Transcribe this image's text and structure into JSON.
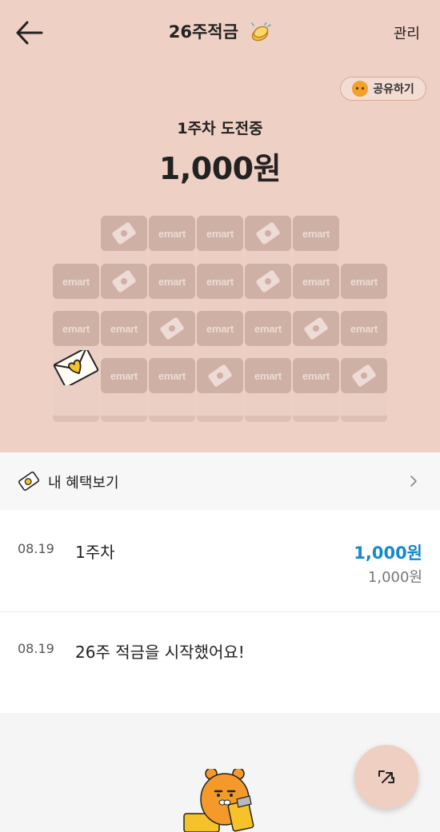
{
  "header": {
    "title": "26주적금",
    "manage_label": "관리"
  },
  "hero": {
    "share_label": "공유하기",
    "week_status": "1주차 도전중",
    "amount": "1,000원"
  },
  "coupon_grid": {
    "tiles": [
      {
        "col": 1,
        "row": 0,
        "type": "coupon"
      },
      {
        "col": 2,
        "row": 0,
        "type": "emart"
      },
      {
        "col": 3,
        "row": 0,
        "type": "emart"
      },
      {
        "col": 4,
        "row": 0,
        "type": "coupon"
      },
      {
        "col": 5,
        "row": 0,
        "type": "emart"
      },
      {
        "col": 0,
        "row": 1,
        "type": "emart"
      },
      {
        "col": 1,
        "row": 1,
        "type": "coupon"
      },
      {
        "col": 2,
        "row": 1,
        "type": "emart"
      },
      {
        "col": 3,
        "row": 1,
        "type": "emart"
      },
      {
        "col": 4,
        "row": 1,
        "type": "coupon"
      },
      {
        "col": 5,
        "row": 1,
        "type": "emart"
      },
      {
        "col": 6,
        "row": 1,
        "type": "emart"
      },
      {
        "col": 0,
        "row": 2,
        "type": "emart"
      },
      {
        "col": 1,
        "row": 2,
        "type": "emart"
      },
      {
        "col": 2,
        "row": 2,
        "type": "coupon"
      },
      {
        "col": 3,
        "row": 2,
        "type": "emart"
      },
      {
        "col": 4,
        "row": 2,
        "type": "emart"
      },
      {
        "col": 5,
        "row": 2,
        "type": "coupon"
      },
      {
        "col": 6,
        "row": 2,
        "type": "emart"
      },
      {
        "col": 1,
        "row": 3,
        "type": "emart"
      },
      {
        "col": 2,
        "row": 3,
        "type": "emart"
      },
      {
        "col": 3,
        "row": 3,
        "type": "coupon"
      },
      {
        "col": 4,
        "row": 3,
        "type": "emart"
      },
      {
        "col": 5,
        "row": 3,
        "type": "emart"
      },
      {
        "col": 6,
        "row": 3,
        "type": "coupon"
      }
    ],
    "tile_text": "emart",
    "completed_weeks": 1
  },
  "benefit": {
    "label": "내 혜택보기"
  },
  "history": [
    {
      "date": "08.19",
      "desc": "1주차",
      "amount": "1,000원",
      "balance": "1,000원"
    },
    {
      "date": "08.19",
      "desc": "26주 적금을 시작했어요!"
    }
  ],
  "colors": {
    "hero_bg": "#efd0c4",
    "accent_amount": "#1689c9",
    "tile": "#cfb0a4"
  }
}
